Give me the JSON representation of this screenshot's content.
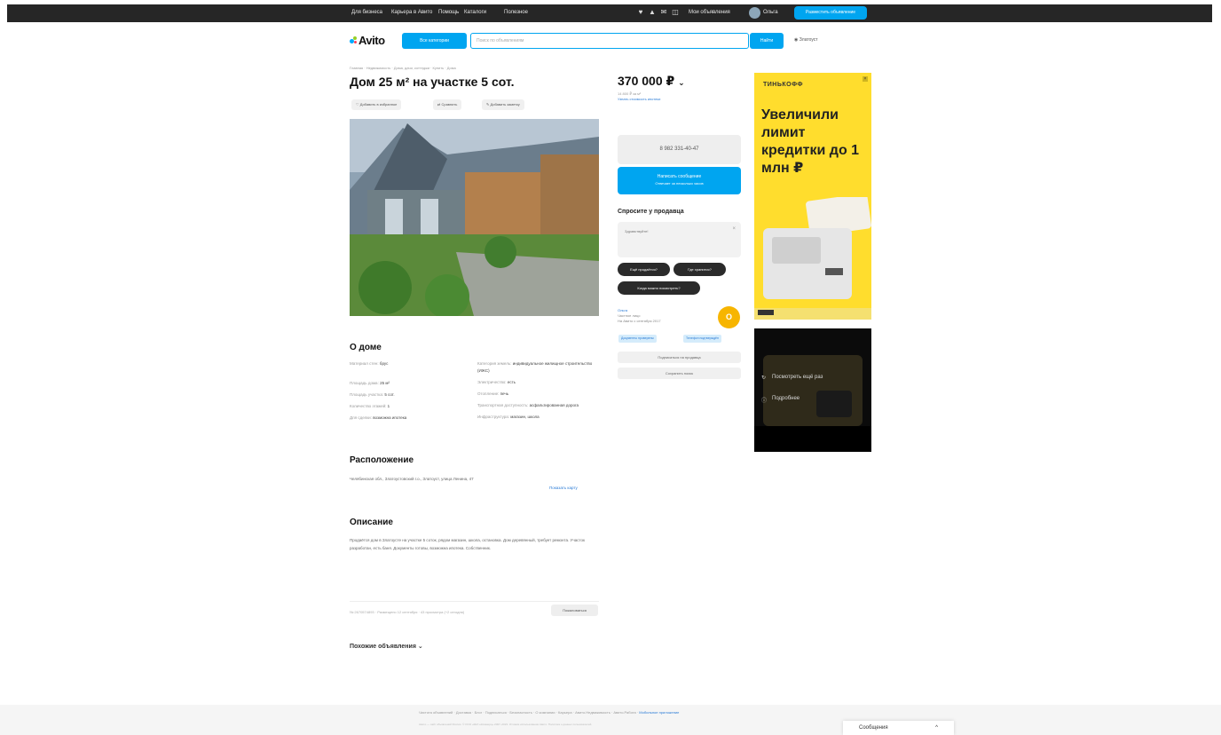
{
  "topbar": {
    "links": [
      "Для бизнеса",
      "Карьера в Авито",
      "Помощь",
      "Каталоги",
      "Полезное"
    ],
    "user": "Мои объявления",
    "profile": "Ольга",
    "post_ad": "Разместить объявление"
  },
  "header": {
    "logo": "Avito",
    "categories_button": "Все категории",
    "search_placeholder": "Поиск по объявлениям",
    "find_button": "Найти",
    "location": "Златоуст"
  },
  "listing": {
    "breadcrumbs": "Главная · Недвижимость · Дома, дачи, коттеджи · Купить · Дома",
    "title": "Дом 25 м² на участке 5 сот.",
    "actions": [
      "Добавить в избранное",
      "Сравнить",
      "Добавить заметку"
    ],
    "price": "370 000 ₽",
    "price_chevron": "⌄",
    "price_sub1": "14 800 ₽ за м²",
    "price_sub2": "Узнать стоимость ипотеки",
    "phone": "8 982 331-40-47",
    "write_button_line1": "Написать сообщение",
    "write_button_line2": "Отвечает за несколько часов",
    "ask_title": "Спросите у продавца",
    "ask_placeholder": "Здравствуйте!",
    "ask_close": "×",
    "chips": [
      "Ещё продаётся?",
      "Где хранится?",
      "Когда можно посмотреть?"
    ],
    "seller_name": "Ольга",
    "seller_type": "Частное лицо",
    "seller_since": "На Авито с сентября 2017",
    "seller_avatar_letter": "О",
    "seller_tags": [
      "Документы проверены",
      "Телефон подтверждён"
    ],
    "subscribe_button": "Подписаться на продавца",
    "saved_button": "Сохранить поиск"
  },
  "about": {
    "title": "О доме",
    "left_params": [
      {
        "k": "Материал стен:",
        "v": "брус"
      },
      {
        "k": "Площадь дома:",
        "v": "25 м²"
      },
      {
        "k": "Площадь участка:",
        "v": "5 сот."
      },
      {
        "k": "Количество этажей:",
        "v": "1"
      },
      {
        "k": "Для сделки:",
        "v": "возможна ипотека"
      }
    ],
    "right_params": [
      {
        "k": "Категория земель:",
        "v": "индивидуальное жилищное строительство (ИЖС)"
      },
      {
        "k": "Электричество:",
        "v": "есть"
      },
      {
        "k": "Отопление:",
        "v": "печь"
      },
      {
        "k": "Транспортная доступность:",
        "v": "асфальтированная дорога"
      },
      {
        "k": "Инфраструктура:",
        "v": "магазин, школа"
      }
    ]
  },
  "location": {
    "title": "Расположение",
    "address": "Челябинская обл., Златоустовский г.о., Златоуст, улица Ленина, 47",
    "map_link": "Показать карту"
  },
  "description": {
    "title": "Описание",
    "text": "Продаётся дом в Златоусте на участке 5 соток, рядом магазин, школа, остановка. Дом деревянный, требует ремонта. Участок разработан, есть баня. Документы готовы, возможна ипотека. Собственник."
  },
  "meta": {
    "stats": "№ 2670574893 · Размещено 12 сентября · 43 просмотра (+2 сегодня)",
    "complain_button": "Пожаловаться",
    "similar": "Похожие объявления",
    "similar_chevron": "⌄"
  },
  "ads": {
    "brand": "ТИНЬКОФФ",
    "headline": "Увеличили лимит кредитки до 1 млн ₽",
    "video_text1": "Посмотреть ещё раз",
    "video_text2": "Подробнее"
  },
  "footer": {
    "links": [
      "Чистота объявлений",
      "Доставка",
      "Блог",
      "Подписаться",
      "Безопасность",
      "О компании",
      "Карьера",
      "Авито.Недвижимость",
      "Авито.Работа"
    ],
    "last_link": "Мобильное приложение",
    "small": "Авито — сайт объявлений России. © ООО «КЕХ еКоммерц» 2007–2023. Условия использования Авито. Политика о данных пользователей."
  },
  "messenger": {
    "label": "Сообщения",
    "chevron": "^"
  },
  "colors": {
    "accent": "#00a5f0",
    "topbar": "#262626",
    "ad_yellow": "#ffdd2d",
    "chip_dark": "#2b2b2b"
  }
}
